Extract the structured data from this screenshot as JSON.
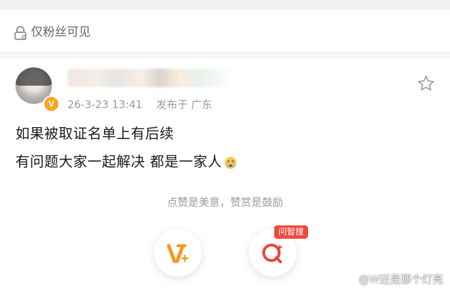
{
  "visibility": {
    "label": "仅粉丝可见",
    "icon": "lock-icon"
  },
  "post": {
    "timestamp": "26-3-23 13:41",
    "location": "发布于 广东",
    "lines": [
      "如果被取证名单上有后续",
      "有问题大家一起解决 都是一家人"
    ],
    "emoji": "crying-face-emoji"
  },
  "reward": {
    "hint": "点赞是美意，赞赏是鼓励",
    "search_tag": "问智搜"
  },
  "watermark": "@W还是那个灯亮",
  "colors": {
    "accent_orange": "#f5a623",
    "search_red": "#ea4b3c",
    "muted_text": "#9a9a9a"
  }
}
